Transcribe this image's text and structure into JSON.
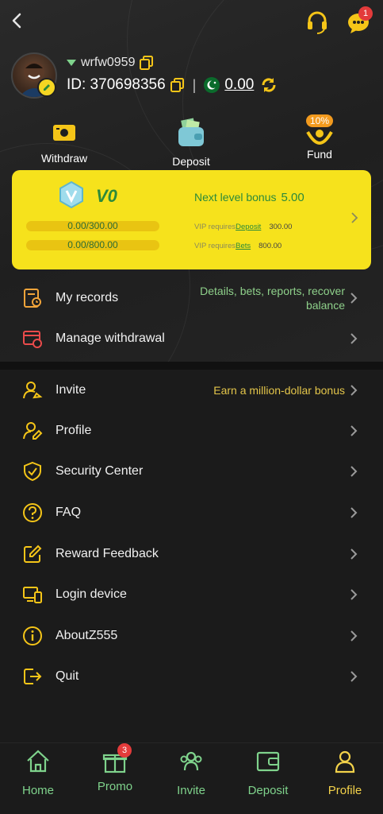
{
  "header": {
    "username": "wrfw0959",
    "id_label": "ID: 370698356",
    "separator": "|",
    "balance": "0.00",
    "message_count": "1"
  },
  "quick_actions": [
    {
      "label": "Withdraw",
      "icon": "withdraw-icon"
    },
    {
      "label": "Deposit",
      "icon": "wallet-icon"
    },
    {
      "label": "Fund",
      "icon": "fund-hands-icon",
      "badge": "10%"
    }
  ],
  "vip": {
    "level": "V0",
    "next_label": "Next level bonus",
    "next_value": "5.00",
    "deposit_progress": "0.00/300.00",
    "deposit_fraction": 0,
    "bets_progress": "0.00/800.00",
    "bets_fraction": 0,
    "req_prefix": "VIP requires",
    "req_deposit_link": "Deposit",
    "req_deposit_amount": "300.00",
    "req_bets_link": "Bets",
    "req_bets_amount": "800.00"
  },
  "records": [
    {
      "label": "My records",
      "aside": "Details, bets, reports, recover",
      "aside2": "balance",
      "icon": "records-icon"
    },
    {
      "label": "Manage withdrawal",
      "aside": "",
      "icon": "manage-withdrawal-icon"
    }
  ],
  "menu": [
    {
      "label": "Invite",
      "aside": "Earn a million-dollar bonus",
      "icon": "invite-user-icon"
    },
    {
      "label": "Profile",
      "aside": "",
      "icon": "profile-edit-icon"
    },
    {
      "label": "Security Center",
      "aside": "",
      "icon": "shield-check-icon"
    },
    {
      "label": "FAQ",
      "aside": "",
      "icon": "question-icon"
    },
    {
      "label": "Reward Feedback",
      "aside": "",
      "icon": "feedback-edit-icon"
    },
    {
      "label": "Login device",
      "aside": "",
      "icon": "devices-icon"
    },
    {
      "label": "AboutZ555",
      "aside": "",
      "icon": "info-icon"
    },
    {
      "label": "Quit",
      "aside": "",
      "icon": "logout-icon"
    }
  ],
  "nav": [
    {
      "label": "Home",
      "icon": "home-icon"
    },
    {
      "label": "Promo",
      "icon": "gift-icon",
      "badge": "3"
    },
    {
      "label": "Invite",
      "icon": "group-icon"
    },
    {
      "label": "Deposit",
      "icon": "wallet-icon"
    },
    {
      "label": "Profile",
      "icon": "person-icon"
    }
  ],
  "colors": {
    "accent_yellow": "#f6e21c",
    "nav_yellow": "#f3d24a",
    "green": "#2c8a3a",
    "background": "#1b1b1b",
    "badge_red": "#e33b3b"
  }
}
